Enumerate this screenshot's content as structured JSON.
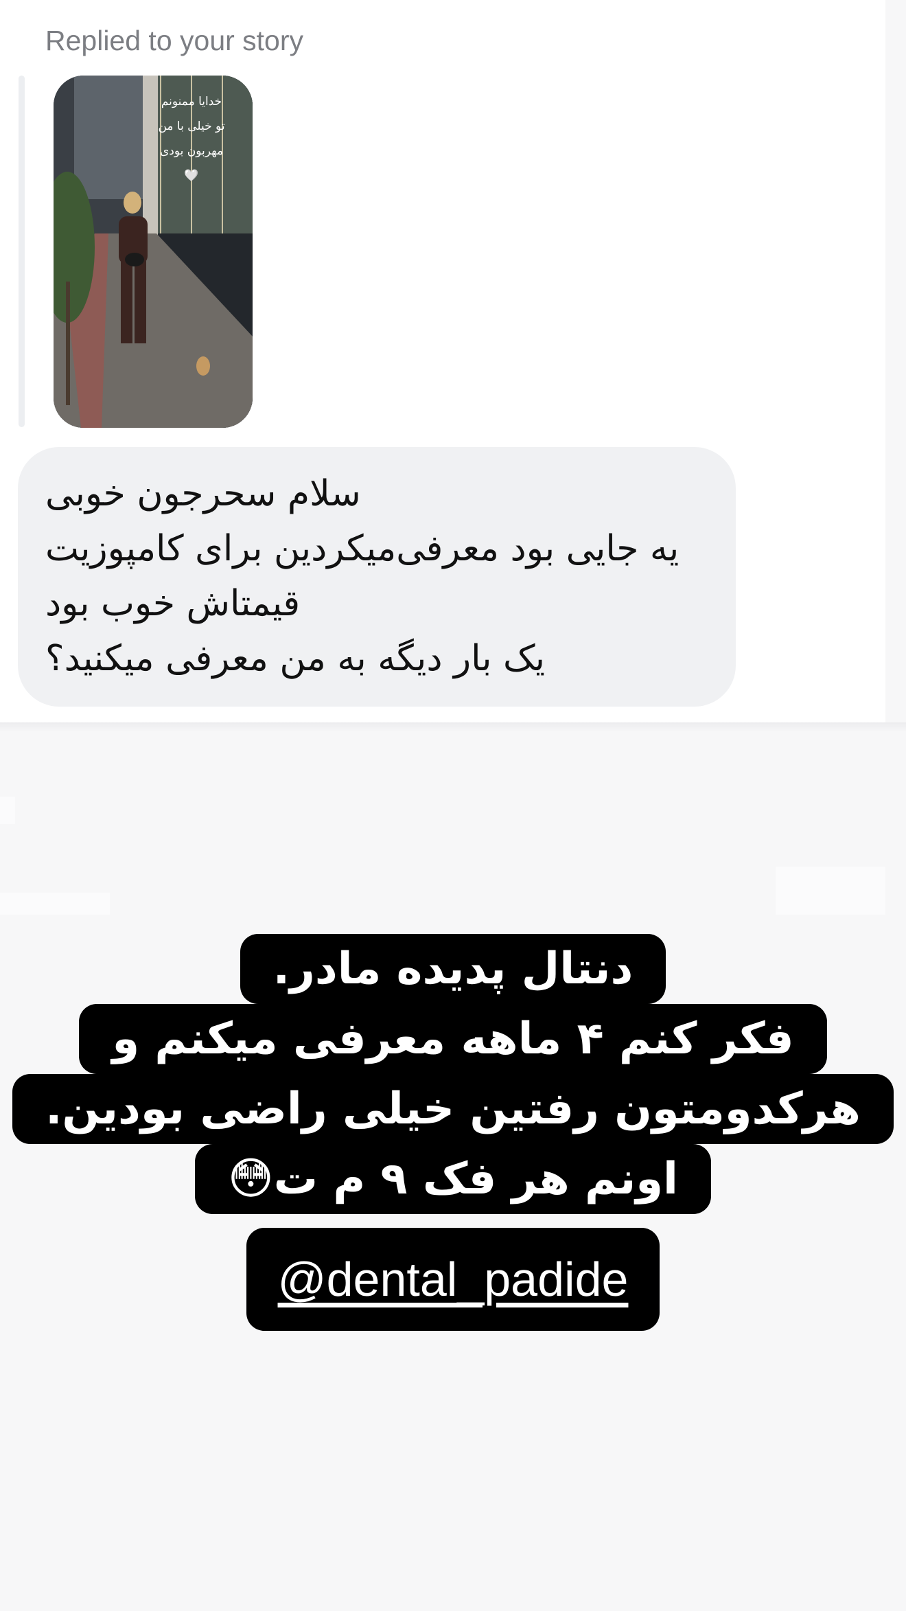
{
  "reply_header": {
    "label": "Replied to your story"
  },
  "story_preview": {
    "overlay_lines": [
      "خدایا ممنونم",
      "تو خیلی با من",
      "مهربون بودی",
      "🤍"
    ]
  },
  "message": {
    "lines": [
      "سلام سحرجون خوبی",
      "یه جایی بود معرفی‌میکردین برای کامپوزیت",
      "قیمتاش خوب بود",
      "یک بار دیگه به من معرفی میکنید؟"
    ]
  },
  "caption": {
    "lines": [
      "دنتال پدیده مادر.",
      "فکر کنم ۴ ماهه معرفی میکنم و",
      "هرکدومتون رفتین خیلی راضی بودین.",
      "اونم هر فک ۹ م ت😳"
    ],
    "mention": "@dental_padide"
  },
  "colors": {
    "bubble": "#f0f1f3",
    "caption_bg": "#000000",
    "caption_text": "#ffffff",
    "meta_text": "#7c7e83"
  }
}
